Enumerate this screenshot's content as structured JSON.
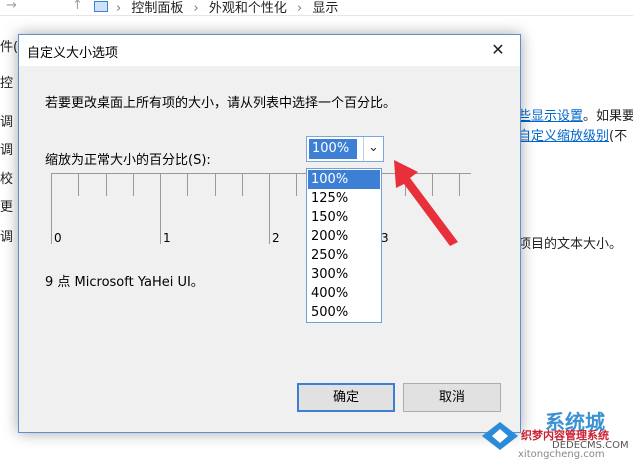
{
  "background": {
    "nav_arrows": [
      "→",
      "↑"
    ],
    "breadcrumb": [
      "控制面板",
      "外观和个性化",
      "显示"
    ],
    "left_fragments": [
      "件(F",
      "控",
      "调",
      "调",
      "校",
      "更",
      "调"
    ],
    "right_fragments": {
      "link1": "些显示设置",
      "after1": "。如果要",
      "link2": "自定义缩放级别",
      "after2": "(不",
      "line3": "项目的文本大小。"
    }
  },
  "dialog": {
    "title": "自定义大小选项",
    "close": "✕",
    "instruction": "若要更改桌面上所有项的大小，请从列表中选择一个百分比。",
    "scale_label": "缩放为正常大小的百分比(S):",
    "selected_value": "100%",
    "dropdown_arrow": "⌄",
    "options": [
      "100%",
      "125%",
      "150%",
      "200%",
      "250%",
      "300%",
      "400%",
      "500%"
    ],
    "ruler_numbers": [
      "0",
      "1",
      "2",
      "3"
    ],
    "font_info": "9 点 Microsoft YaHei UI。",
    "ok_label": "确定",
    "cancel_label": "取消"
  },
  "watermark": {
    "site": "系统城",
    "sub": "织梦内容管理系统",
    "url": "DEDECMS.COM",
    "bottom": "xitongcheng.com"
  },
  "colors": {
    "accent": "#3c7fd4",
    "annotation": "#e8303a",
    "link": "#0066cc"
  }
}
